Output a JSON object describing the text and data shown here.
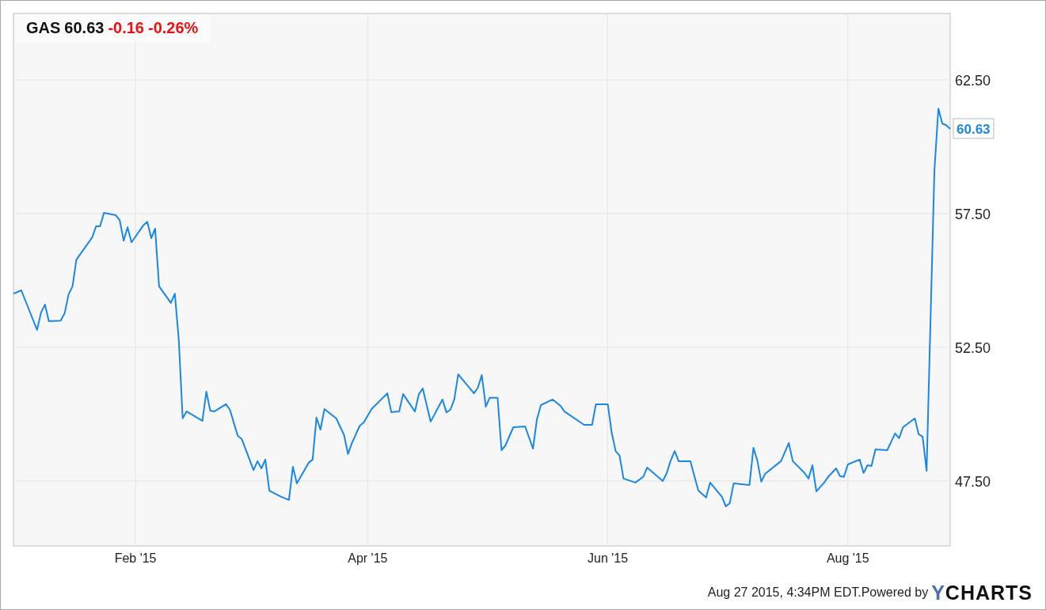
{
  "chart": {
    "header": {
      "symbol": "GAS",
      "price": "60.63",
      "change": "-0.16",
      "change_pct": "-0.26%"
    },
    "chart_data": {
      "type": "line",
      "categories": [
        null,
        null,
        null,
        null,
        null,
        null,
        null,
        null,
        null,
        null,
        null,
        null,
        null,
        null,
        null,
        null,
        null,
        null,
        null,
        null,
        null,
        null,
        null,
        null,
        null,
        null,
        null,
        null,
        null,
        null,
        null,
        "Feb '15",
        null,
        null,
        null,
        null,
        null,
        null,
        null,
        null,
        null,
        null,
        null,
        null,
        null,
        null,
        null,
        null,
        null,
        null,
        null,
        null,
        null,
        null,
        null,
        null,
        null,
        null,
        null,
        null,
        null,
        null,
        null,
        null,
        null,
        null,
        null,
        null,
        null,
        null,
        null,
        null,
        null,
        null,
        null,
        null,
        null,
        null,
        null,
        null,
        null,
        null,
        null,
        null,
        null,
        null,
        null,
        null,
        null,
        null,
        "Apr '15",
        null,
        null,
        null,
        null,
        null,
        null,
        null,
        null,
        null,
        null,
        null,
        null,
        null,
        null,
        null,
        null,
        null,
        null,
        null,
        null,
        null,
        null,
        null,
        null,
        null,
        null,
        null,
        null,
        null,
        null,
        null,
        null,
        null,
        null,
        null,
        null,
        null,
        null,
        null,
        null,
        null,
        null,
        null,
        null,
        null,
        null,
        null,
        null,
        null,
        null,
        null,
        null,
        null,
        null,
        null,
        null,
        null,
        null,
        null,
        null,
        "Jun '15",
        null,
        null,
        null,
        null,
        null,
        null,
        null,
        null,
        null,
        null,
        null,
        null,
        null,
        null,
        null,
        null,
        null,
        null,
        null,
        null,
        null,
        null,
        null,
        null,
        null,
        null,
        null,
        null,
        null,
        null,
        null,
        null,
        null,
        null,
        null,
        null,
        null,
        null,
        null,
        null,
        null,
        null,
        null,
        null,
        null,
        null,
        null,
        null,
        null,
        null,
        null,
        null,
        null,
        null,
        null,
        null,
        null,
        null,
        null,
        null,
        "Aug '15",
        null,
        null,
        null,
        null,
        null,
        null,
        null,
        null,
        null,
        null,
        null,
        null,
        null,
        null,
        null,
        null,
        null,
        null,
        null,
        null,
        null,
        null,
        null,
        null,
        null,
        null
      ],
      "series": [
        {
          "color": "#1a87e6",
          "values": [
            54.51,
            null,
            54.63,
            null,
            null,
            null,
            53.15,
            53.8,
            54.1,
            53.48,
            null,
            null,
            53.5,
            53.77,
            54.48,
            54.78,
            55.78,
            null,
            null,
            null,
            56.61,
            57.03,
            57.03,
            57.53,
            null,
            null,
            57.44,
            57.26,
            56.49,
            56.99,
            56.43,
            null,
            null,
            57.06,
            57.2,
            56.58,
            56.94,
            54.78,
            null,
            null,
            54.16,
            54.51,
            52.77,
            49.84,
            50.1,
            null,
            null,
            null,
            49.75,
            50.84,
            50.13,
            50.1,
            null,
            null,
            50.37,
            50.16,
            49.66,
            49.19,
            49.07,
            null,
            null,
            47.91,
            48.24,
            47.97,
            48.3,
            47.14,
            null,
            null,
            46.91,
            null,
            46.79,
            48.03,
            47.41,
            null,
            null,
            48.18,
            48.3,
            49.87,
            49.42,
            50.19,
            null,
            null,
            49.84,
            null,
            49.22,
            48.51,
            48.92,
            null,
            49.57,
            49.69,
            null,
            50.19,
            null,
            null,
            null,
            50.78,
            50.07,
            null,
            50.1,
            50.75,
            null,
            null,
            50.1,
            50.75,
            50.96,
            null,
            49.72,
            null,
            null,
            50.55,
            50.07,
            50.16,
            50.55,
            51.49,
            null,
            null,
            null,
            50.78,
            50.99,
            51.46,
            50.28,
            50.61,
            null,
            50.61,
            48.65,
            48.83,
            null,
            49.51,
            null,
            null,
            49.54,
            null,
            48.71,
            49.81,
            50.34,
            null,
            null,
            50.55,
            null,
            50.31,
            50.1,
            null,
            null,
            null,
            null,
            49.6,
            null,
            49.6,
            50.37,
            null,
            null,
            50.37,
            49.31,
            48.62,
            48.45,
            47.59,
            null,
            null,
            47.44,
            null,
            47.65,
            48.0,
            null,
            null,
            null,
            47.5,
            47.8,
            48.27,
            48.62,
            48.24,
            null,
            null,
            48.24,
            null,
            47.14,
            null,
            46.88,
            47.44,
            null,
            null,
            46.91,
            46.55,
            46.67,
            47.41,
            null,
            null,
            null,
            47.35,
            48.74,
            48.27,
            47.47,
            47.77,
            null,
            null,
            null,
            48.24,
            null,
            48.92,
            48.24,
            null,
            null,
            47.8,
            47.59,
            48.09,
            47.11,
            null,
            47.44,
            47.65,
            null,
            47.97,
            47.68,
            47.65,
            48.12,
            null,
            null,
            48.3,
            47.8,
            48.09,
            48.06,
            48.68,
            null,
            null,
            48.65,
            null,
            49.28,
            49.1,
            49.51,
            null,
            null,
            49.84,
            49.25,
            49.16,
            47.88,
            null,
            59.13,
            61.43,
            60.87,
            60.81,
            60.67
          ]
        }
      ],
      "ylim": [
        45.07,
        64.99
      ],
      "yticks": [
        {
          "value": 47.5,
          "label": "47.50"
        },
        {
          "value": 52.5,
          "label": "52.50"
        },
        {
          "value": 57.5,
          "label": "57.50"
        },
        {
          "value": 62.5,
          "label": "62.50"
        }
      ],
      "grid": true,
      "annotations": [
        "60.63"
      ]
    }
  },
  "footer": {
    "timestamp": "Aug 27 2015, 4:34PM EDT.",
    "powered_by": "Powered by",
    "logo": "YCHARTS"
  }
}
